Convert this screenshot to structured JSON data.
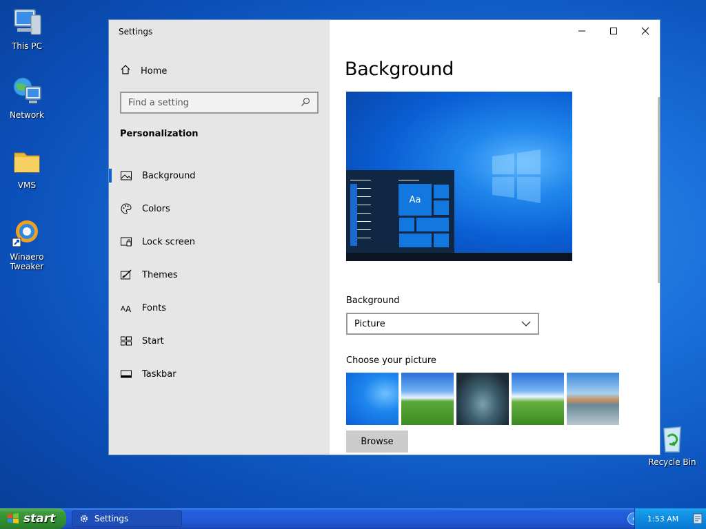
{
  "desktop": {
    "icons": [
      {
        "label": "This PC",
        "icon": "computer-icon"
      },
      {
        "label": "Network",
        "icon": "network-icon"
      },
      {
        "label": "VMS",
        "icon": "folder-icon"
      },
      {
        "label": "Winaero Tweaker",
        "icon": "winaero-tweaker-icon"
      },
      {
        "label": "Recycle Bin",
        "icon": "recycle-bin-icon"
      }
    ]
  },
  "window": {
    "title": "Settings",
    "controls": {
      "minimize": "minimize-icon",
      "maximize": "maximize-icon",
      "close": "close-icon"
    }
  },
  "nav": {
    "home_label": "Home",
    "search_placeholder": "Find a setting",
    "section": "Personalization",
    "items": [
      {
        "label": "Background",
        "icon": "background-icon",
        "active": true
      },
      {
        "label": "Colors",
        "icon": "palette-icon",
        "active": false
      },
      {
        "label": "Lock screen",
        "icon": "lock-screen-icon",
        "active": false
      },
      {
        "label": "Themes",
        "icon": "themes-icon",
        "active": false
      },
      {
        "label": "Fonts",
        "icon": "fonts-icon",
        "active": false
      },
      {
        "label": "Start",
        "icon": "start-icon",
        "active": false
      },
      {
        "label": "Taskbar",
        "icon": "taskbar-icon",
        "active": false
      }
    ]
  },
  "content": {
    "title": "Background",
    "preview_tile_text": "Aa",
    "background_label": "Background",
    "background_value": "Picture",
    "choose_label": "Choose your picture",
    "browse_label": "Browse"
  },
  "taskbar": {
    "start_label": "start",
    "task_label": "Settings",
    "clock": "1:53 AM"
  },
  "colors": {
    "accent": "#0a64d6",
    "taskbar": "#245edc",
    "start": "#3c9a3c"
  }
}
